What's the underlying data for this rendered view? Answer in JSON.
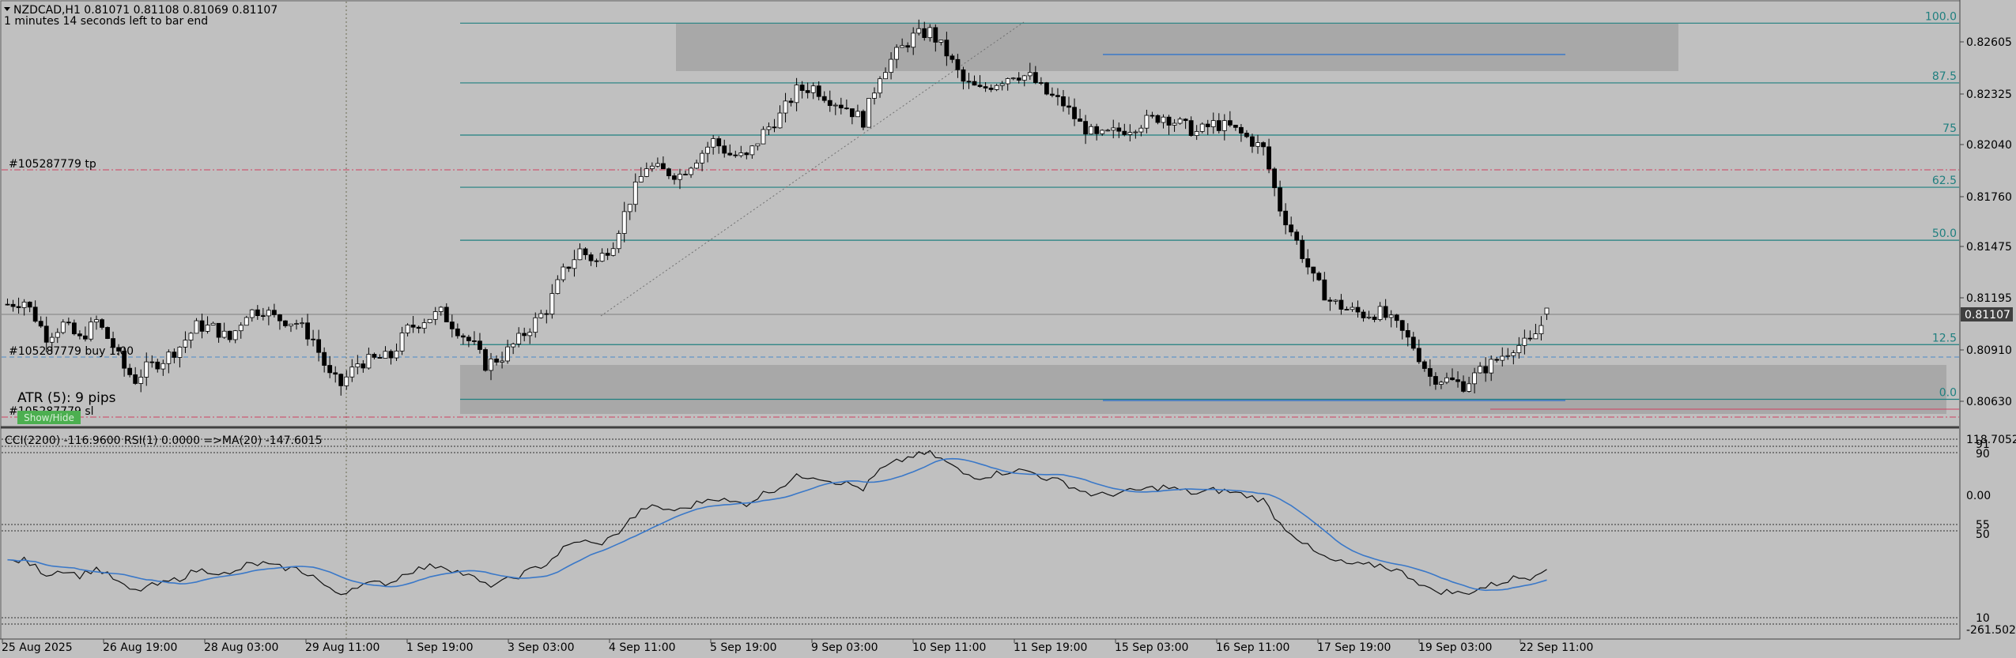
{
  "header": {
    "symbol_line": "NZDCAD,H1  0.81071 0.81108 0.81069 0.81107",
    "timer": "1 minutes 14 seconds left to bar end"
  },
  "labels": {
    "tp": "#105287779 tp",
    "buy": "#105287779 buy 1.00",
    "sl": "#105287779 sl",
    "atr": "ATR (5): 9 pips",
    "atr_badge": "Show/Hide"
  },
  "fib_levels": [
    {
      "label": "100.0",
      "price": 0.828
    },
    {
      "label": "87.5",
      "price": 0.82445
    },
    {
      "label": "75",
      "price": 0.82135
    },
    {
      "label": "62.5",
      "price": 0.81825
    },
    {
      "label": "50.0",
      "price": 0.8151
    },
    {
      "label": "12.5",
      "price": 0.8089
    },
    {
      "label": "0.0",
      "price": 0.80565
    }
  ],
  "price_axis": [
    "0.82605",
    "0.82325",
    "0.82040",
    "0.81760",
    "0.81475",
    "0.81195",
    "0.80910",
    "0.80630"
  ],
  "current_price": "0.81107",
  "indicator": {
    "title": "CCI(2200) -116.9600  RSI(1) 0.0000  =>MA(20) -147.6015",
    "axis": [
      "118.7052",
      "91",
      "90",
      "0.00",
      "55",
      "50",
      "10",
      "-261.5025"
    ]
  },
  "time_axis": [
    "25 Aug 2025",
    "26 Aug 19:00",
    "28 Aug 03:00",
    "29 Aug 11:00",
    "1 Sep 19:00",
    "3 Sep 03:00",
    "4 Sep 11:00",
    "5 Sep 19:00",
    "9 Sep 03:00",
    "10 Sep 11:00",
    "11 Sep 19:00",
    "15 Sep 03:00",
    "16 Sep 11:00",
    "17 Sep 19:00",
    "19 Sep 03:00",
    "22 Sep 11:00"
  ],
  "colors": {
    "background": "#c0c0c0",
    "fib_line": "#1f7f7f",
    "zone": "#a8a8a8",
    "trade_line": "#d04060",
    "ma_line": "#3a78c8",
    "price_tag": "#404040"
  },
  "chart_data": {
    "type": "candlestick",
    "symbol": "NZDCAD",
    "timeframe": "H1",
    "ylim": [
      0.8045,
      0.829
    ],
    "anchors": [
      [
        0,
        0.8113
      ],
      [
        3,
        0.8115
      ],
      [
        5,
        0.8105
      ],
      [
        7,
        0.8094
      ],
      [
        10,
        0.8101
      ],
      [
        13,
        0.8092
      ],
      [
        16,
        0.8103
      ],
      [
        19,
        0.8088
      ],
      [
        21,
        0.8075
      ],
      [
        23,
        0.8068
      ],
      [
        25,
        0.8075
      ],
      [
        28,
        0.808
      ],
      [
        31,
        0.8088
      ],
      [
        34,
        0.81
      ],
      [
        37,
        0.8099
      ],
      [
        40,
        0.8092
      ],
      [
        43,
        0.8108
      ],
      [
        46,
        0.811
      ],
      [
        48,
        0.8105
      ],
      [
        52,
        0.8102
      ],
      [
        55,
        0.8092
      ],
      [
        58,
        0.807
      ],
      [
        60,
        0.8065
      ],
      [
        63,
        0.8078
      ],
      [
        66,
        0.808
      ],
      [
        69,
        0.8082
      ],
      [
        72,
        0.8098
      ],
      [
        75,
        0.8104
      ],
      [
        78,
        0.8108
      ],
      [
        81,
        0.8098
      ],
      [
        84,
        0.8088
      ],
      [
        86,
        0.8077
      ],
      [
        89,
        0.8082
      ],
      [
        92,
        0.8092
      ],
      [
        95,
        0.8103
      ],
      [
        97,
        0.811
      ],
      [
        100,
        0.8132
      ],
      [
        103,
        0.8145
      ],
      [
        106,
        0.8138
      ],
      [
        109,
        0.815
      ],
      [
        112,
        0.8175
      ],
      [
        115,
        0.8195
      ],
      [
        118,
        0.8192
      ],
      [
        121,
        0.819
      ],
      [
        124,
        0.82
      ],
      [
        127,
        0.821
      ],
      [
        130,
        0.8202
      ],
      [
        133,
        0.82
      ],
      [
        136,
        0.8215
      ],
      [
        139,
        0.8225
      ],
      [
        142,
        0.824
      ],
      [
        145,
        0.8242
      ],
      [
        148,
        0.8235
      ],
      [
        151,
        0.823
      ],
      [
        154,
        0.8222
      ],
      [
        157,
        0.825
      ],
      [
        160,
        0.8262
      ],
      [
        163,
        0.8272
      ],
      [
        166,
        0.8275
      ],
      [
        169,
        0.8262
      ],
      [
        172,
        0.8245
      ],
      [
        175,
        0.824
      ],
      [
        178,
        0.8245
      ],
      [
        181,
        0.825
      ],
      [
        184,
        0.8248
      ],
      [
        187,
        0.8238
      ],
      [
        190,
        0.8232
      ],
      [
        193,
        0.822
      ],
      [
        196,
        0.8212
      ],
      [
        199,
        0.8215
      ],
      [
        202,
        0.8218
      ],
      [
        205,
        0.8222
      ],
      [
        208,
        0.8225
      ],
      [
        211,
        0.822
      ],
      [
        214,
        0.8215
      ],
      [
        217,
        0.822
      ],
      [
        220,
        0.8218
      ],
      [
        223,
        0.8212
      ],
      [
        226,
        0.8205
      ],
      [
        229,
        0.817
      ],
      [
        232,
        0.815
      ],
      [
        235,
        0.8128
      ],
      [
        238,
        0.8115
      ],
      [
        241,
        0.811
      ],
      [
        244,
        0.8107
      ],
      [
        247,
        0.8108
      ],
      [
        250,
        0.81
      ],
      [
        253,
        0.8088
      ],
      [
        256,
        0.807
      ],
      [
        259,
        0.8068
      ],
      [
        262,
        0.8065
      ],
      [
        265,
        0.8073
      ],
      [
        268,
        0.808
      ],
      [
        271,
        0.8088
      ],
      [
        274,
        0.809
      ],
      [
        277,
        0.8106
      ]
    ],
    "last_bar": {
      "open": 0.81071,
      "high": 0.81108,
      "low": 0.81069,
      "close": 0.81107
    }
  }
}
